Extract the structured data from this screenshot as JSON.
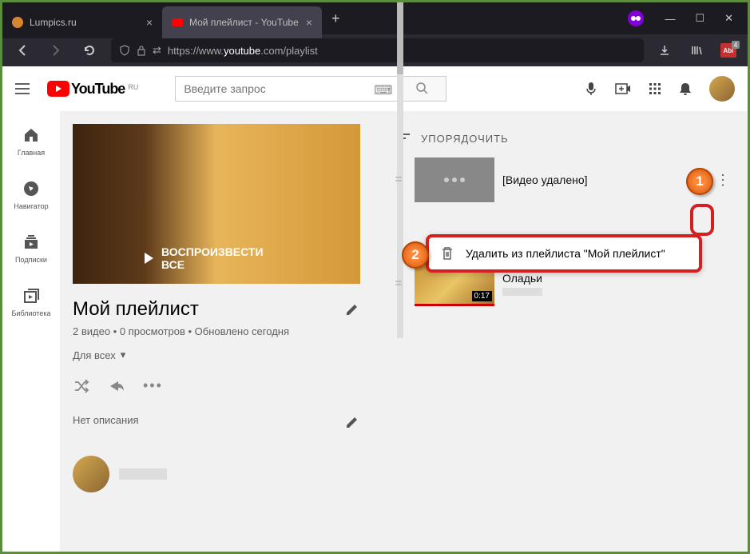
{
  "browser": {
    "tabs": [
      {
        "label": "Lumpics.ru"
      },
      {
        "label": "Мой плейлист - YouTube"
      }
    ],
    "url_prefix": "https://www.",
    "url_host": "youtube",
    "url_suffix": ".com/playlist",
    "ext_badge": "4"
  },
  "yt": {
    "locale": "RU",
    "brand": "YouTube",
    "search_placeholder": "Введите запрос"
  },
  "sidebar": [
    {
      "label": "Главная"
    },
    {
      "label": "Навигатор"
    },
    {
      "label": "Подписки"
    },
    {
      "label": "Библиотека"
    }
  ],
  "playlist": {
    "hero_cta": "ВОСПРОИЗВЕСТИ ВСЕ",
    "title": "Мой плейлист",
    "meta": "2 видео • 0 просмотров • Обновлено сегодня",
    "privacy": "Для всех",
    "no_description": "Нет описания",
    "sort_label": "УПОРЯДОЧИТЬ",
    "videos": [
      {
        "title": "[Видео удалено]",
        "duration": ""
      },
      {
        "title": "Оладьи",
        "duration": "0:17"
      }
    ],
    "menu_action": "Удалить из плейлиста \"Мой плейлист\""
  },
  "callouts": {
    "c1": "1",
    "c2": "2"
  }
}
